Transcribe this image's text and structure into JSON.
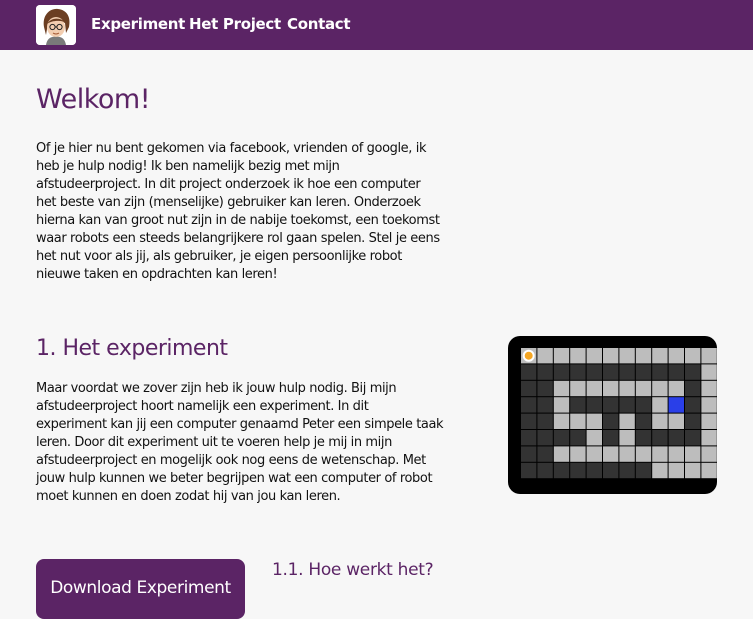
{
  "nav": {
    "logo": "avatar-icon",
    "links": [
      "Experiment",
      "Het Project",
      "Contact"
    ]
  },
  "welcome": {
    "title": "Welkom!",
    "lines": [
      "Of je hier nu bent gekomen via facebook, vrienden of google, ik",
      "heb je hulp nodig! Ik ben namelijk bezig met mijn",
      "afstudeerproject. In dit project onderzoek ik hoe een computer",
      "het beste van zijn (menselijke) gebruiker kan leren. Onderzoek",
      "hierna kan van groot nut zijn in de nabije toekomst, een toekomst",
      "waar robots een steeds belangrijkere rol gaan spelen. Stel je eens",
      "het nut voor als jij, als gebruiker, je eigen persoonlijke robot",
      "nieuwe taken en opdrachten kan leren!"
    ]
  },
  "experiment": {
    "heading": "1. Het experiment",
    "lines": [
      "Maar voordat we zover zijn heb ik jouw hulp nodig. Bij mijn",
      "afstudeerproject hoort namelijk een experiment. In dit",
      "experiment kan jij een computer genaamd Peter een simpele taak",
      "leren. Door dit experiment uit te voeren help je mij in mijn",
      "afstudeerproject en mogelijk ook nog eens de wetenschap. Met",
      "jouw hulp kunnen we beter begrijpen wat een computer of robot",
      "moet kunnen en doen zodat hij van jou kan leren."
    ],
    "maze": {
      "icon": "maze-grid-icon",
      "colors": {
        "wall": "#333333",
        "path": "#bdbdbd",
        "goal": "#2a3fe8",
        "agent": "#f5a623"
      }
    }
  },
  "how": {
    "heading": "1.1. Hoe werkt het?",
    "download_label": "Download Experiment"
  },
  "theme": {
    "brand": "#5b2465",
    "background": "#f7f7f7"
  }
}
